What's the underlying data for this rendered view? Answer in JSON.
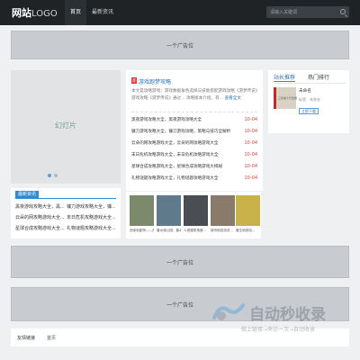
{
  "header": {
    "logo_main": "网站",
    "logo_sub": "LOGO",
    "nav": [
      "首页",
      "最新资讯"
    ],
    "search_placeholder": "请输入关键词"
  },
  "ads": {
    "label": "一个广告位"
  },
  "slideshow": {
    "label": "幻灯片"
  },
  "news_list": {
    "tab": "最新资讯",
    "items": [
      "黑夜游戏攻略大全，黑...",
      "镰刀游戏攻略大全，镰...",
      "云朵的网攻略游戏大全...",
      "末日危机攻略游戏大全...",
      "星球合成攻略游戏大全...",
      "礼物谜题攻略游戏大全..."
    ]
  },
  "feature": {
    "badge": "荐",
    "title": "游戏跑梦攻略",
    "desc": "本文是攻略游戏：游戏数据角色选择与技能搭配游戏攻略《游梦传说》游戏攻略《游梦传说》通过... 攻略版本介绍，有...",
    "more": "查看全文",
    "items": [
      {
        "title": "黑夜游戏攻略大全，黑夜游戏攻略大全",
        "date": "10-04"
      },
      {
        "title": "镰刀游戏攻略大全，镰刀游戏攻略，策略与技巧全解析",
        "date": "10-04"
      },
      {
        "title": "云朵的网攻略游戏大全，云朵的网攻略游戏大全",
        "date": "10-04"
      },
      {
        "title": "末日危机攻略游戏大全，末日危机攻略游戏大全",
        "date": "10-04"
      },
      {
        "title": "星球合成攻略游戏大全，星球合成攻略游戏大揭秘",
        "date": "10-04"
      },
      {
        "title": "礼物谜题攻略游戏大全，礼物谜题攻略游戏大全",
        "date": "10-04"
      }
    ]
  },
  "sidebar": {
    "tabs": [
      "站长推荐",
      "热门排行"
    ],
    "cover_text": "三省暑十行法规",
    "name": "未命名",
    "meta": "标签：未命名",
    "button": "立即下载"
  },
  "tiles": [
    {
      "caption": "西街电影院——西",
      "color": "#7a8a6a"
    },
    {
      "caption": "春水湖公园，春水",
      "color": "#5f7a8a"
    },
    {
      "caption": "人类建筑角度...",
      "color": "#4a4e52"
    },
    {
      "caption": "城市航拍游览...",
      "color": "#8a7a6a"
    },
    {
      "caption": "春生地铁站...",
      "color": "#c9b24a"
    }
  ],
  "friend_links": {
    "label": "友情链接",
    "items": [
      "首页"
    ]
  },
  "watermark": {
    "main": "自动秒收录",
    "sub": "做上链接→来访一次→自动收录"
  }
}
